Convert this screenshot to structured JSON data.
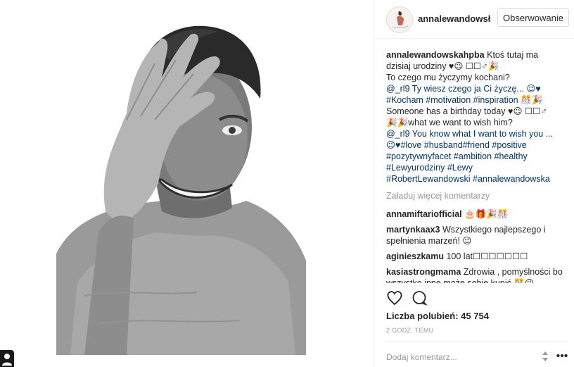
{
  "post": {
    "username_header": "annalewandowsł",
    "follow_label": "Obserwowanie",
    "caption": {
      "username": "annalewandowskahpba",
      "lines": [
        "Ktoś tutaj ma",
        "dzisiaj urodziny ♥😉 ☐☐♂🎉",
        "To czego mu życzymy kochani?",
        "@_rl9 Ty wiesz czego ja Ci życzę... 😉♥",
        "#Kocham #motivation #inspiration 🎊🎉",
        "Someone has a birthday today ♥😉 ☐☐♂",
        "🎉🎉what we want to wish him?",
        "@_rl9 You know what I want to wish you ...",
        "😉♥#love #husband#friend #positive",
        "#pozytywnyfacet #ambition #healthy",
        "#Lewyurodziny #Lewy",
        "#RobertLewandowski #annalewandowska"
      ]
    },
    "load_more": "Załaduj więcej komentarzy",
    "comments": [
      {
        "user": "annamiftariofficial",
        "text": "🎂🎁🎉🎊"
      },
      {
        "user": "martynkaax3",
        "text": "Wszystkiego najlepszego i spełnienia marzeń! 😉"
      },
      {
        "user": "aginieszkamu",
        "text": "100 lat☐☐☐☐☐☐☐"
      },
      {
        "user": "kasiastrongmama",
        "text": "Zdrowia , pomyślności bo wszystko inne może sobie kupić 🎊😉"
      }
    ],
    "likes": "Liczba polubień: 45 754",
    "time": "2 GODZ. TEMU",
    "add_comment_placeholder": "Dodaj komentarz...",
    "more_glyph": "•••"
  },
  "colors": {
    "text": "#262626",
    "muted": "#999999",
    "hashtag": "#003569",
    "border": "#efefef"
  },
  "icons": [
    "heart-icon",
    "comment-icon",
    "scroll-arrows-icon",
    "more-options-icon",
    "user-silhouette-icon"
  ]
}
